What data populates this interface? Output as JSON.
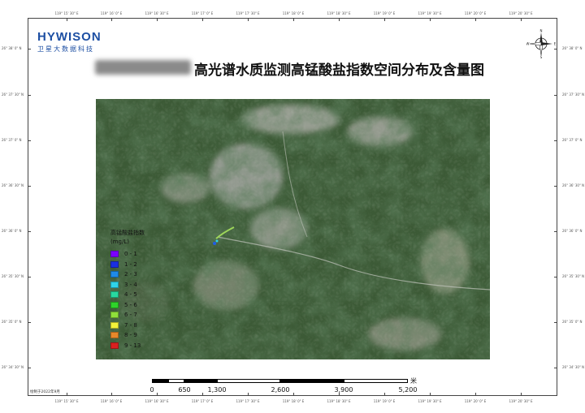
{
  "brand": {
    "logo_name": "HYWISON",
    "logo_subtitle": "卫星大数据科技"
  },
  "header": {
    "title_redacted_prefix": "",
    "title": "高光谱水质监测高锰酸盐指数空间分布及含量图"
  },
  "coordinates": {
    "top": [
      "119° 15' 30\" E",
      "119° 16' 0\" E",
      "119° 16' 30\" E",
      "119° 17' 0\" E",
      "119° 17' 30\" E",
      "119° 18' 0\" E",
      "119° 18' 30\" E",
      "119° 19' 0\" E",
      "119° 19' 30\" E",
      "119° 20' 0\" E",
      "119° 20' 30\" E"
    ],
    "bottom": [
      "119° 15' 30\" E",
      "119° 16' 0\" E",
      "119° 16' 30\" E",
      "119° 17' 0\" E",
      "119° 17' 30\" E",
      "119° 18' 0\" E",
      "119° 18' 30\" E",
      "119° 19' 0\" E",
      "119° 19' 30\" E",
      "119° 20' 0\" E",
      "119° 20' 30\" E"
    ],
    "left": [
      "26° 38' 0\" N",
      "26° 37' 30\" N",
      "26° 37' 0\" N",
      "26° 36' 30\" N",
      "26° 36' 0\" N",
      "26° 35' 30\" N",
      "26° 35' 0\" N",
      "26° 34' 30\" N"
    ],
    "right": [
      "26° 38' 0\" N",
      "26° 37' 30\" N",
      "26° 37' 0\" N",
      "26° 36' 30\" N",
      "26° 36' 0\" N",
      "26° 35' 30\" N",
      "26° 35' 0\" N",
      "26° 34' 30\" N"
    ]
  },
  "north_arrow": {
    "n": "N",
    "s": "S",
    "e": "E",
    "w": "W"
  },
  "legend": {
    "title": "高锰酸盐指数",
    "unit": "(mg/L)",
    "items": [
      {
        "label": "0 - 1",
        "color": "#7b00ff"
      },
      {
        "label": "1 - 2",
        "color": "#1a2fe0"
      },
      {
        "label": "2 - 3",
        "color": "#1f8ae8"
      },
      {
        "label": "3 - 4",
        "color": "#2fd4e8"
      },
      {
        "label": "4 - 5",
        "color": "#28d9a0"
      },
      {
        "label": "5 - 6",
        "color": "#2fd42a"
      },
      {
        "label": "6 - 7",
        "color": "#8fe03a"
      },
      {
        "label": "7 - 8",
        "color": "#f2f23a"
      },
      {
        "label": "8 - 9",
        "color": "#e8882a"
      },
      {
        "label": "9 - 13",
        "color": "#d92020"
      }
    ]
  },
  "scale": {
    "labels": [
      "0",
      "650",
      "1,300",
      "2,600",
      "3,900",
      "5,200"
    ],
    "unit": "米"
  },
  "footer": {
    "maker": "绘制于2022年9月"
  },
  "colors": {
    "brand": "#1d4fa3",
    "forest": "#2f4a2c",
    "bare": "#a8a9a4"
  }
}
